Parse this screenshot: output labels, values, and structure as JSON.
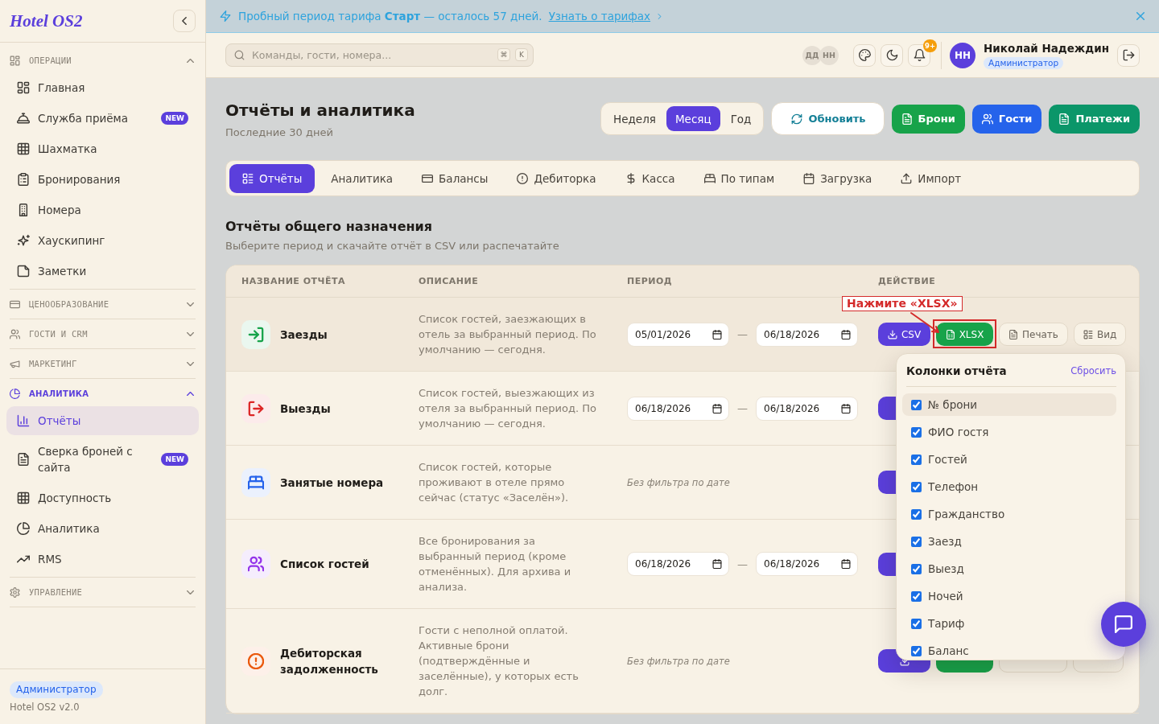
{
  "sidebar": {
    "logo": "Hotel OS2",
    "sections": [
      {
        "kind": "operations",
        "title": "ОПЕРАЦИИ",
        "expanded": true,
        "items": [
          {
            "kind": "dashboard",
            "label": "Главная",
            "selected": false
          },
          {
            "kind": "service-bell",
            "label": "Служба приёма",
            "selected": false,
            "badge": "NEW"
          },
          {
            "kind": "grid",
            "label": "Шахматка",
            "selected": false
          },
          {
            "kind": "clipboard",
            "label": "Бронирования",
            "selected": false
          },
          {
            "kind": "building",
            "label": "Номера",
            "selected": false
          },
          {
            "kind": "sparkles",
            "label": "Хаускипинг",
            "selected": false
          },
          {
            "kind": "note",
            "label": "Заметки",
            "selected": false
          }
        ]
      },
      {
        "kind": "pricing",
        "title": "ЦЕНООБРАЗОВАНИЕ",
        "expanded": false
      },
      {
        "kind": "crm",
        "title": "ГОСТИ И CRM",
        "expanded": false
      },
      {
        "kind": "marketing",
        "title": "МАРКЕТИНГ",
        "expanded": false
      },
      {
        "kind": "analytics",
        "title": "АНАЛИТИКА",
        "expanded": true,
        "items": [
          {
            "kind": "bar-chart",
            "label": "Отчёты",
            "selected": true
          },
          {
            "kind": "document",
            "label": "Сверка броней с сайта",
            "selected": false,
            "badge": "NEW"
          },
          {
            "kind": "grid",
            "label": "Доступность",
            "selected": false
          },
          {
            "kind": "pie-chart",
            "label": "Аналитика",
            "selected": false
          },
          {
            "kind": "trend",
            "label": "RMS",
            "selected": false
          }
        ]
      },
      {
        "kind": "settings",
        "title": "УПРАВЛЕНИЕ",
        "expanded": false
      }
    ],
    "footer": {
      "role": "Администратор",
      "version": "Hotel OS2 v2.0"
    }
  },
  "banner": {
    "text": "Пробный период тарифа **Старт** — осталось 57 дней.",
    "link": "Узнать о тарифах"
  },
  "topbar": {
    "search": {
      "placeholder": "Команды, гости, номера...",
      "shortcut": [
        "⌘",
        "K"
      ]
    },
    "presence": [
      "ДД",
      "НН"
    ],
    "notifications_badge": "9+",
    "user": {
      "initials": "НН",
      "name": "Николай Надеждин",
      "role": "Администратор"
    }
  },
  "page": {
    "title": "Отчёты и аналитика",
    "subtitle": "Последние 30 дней",
    "period_switch": [
      {
        "label": "Неделя",
        "selected": false
      },
      {
        "label": "Месяц",
        "selected": true
      },
      {
        "label": "Год",
        "selected": false
      }
    ],
    "actions": [
      {
        "kind": "refresh",
        "label": "Обновить"
      },
      {
        "kind": "bookings",
        "label": "Брони"
      },
      {
        "kind": "guests",
        "label": "Гости"
      },
      {
        "kind": "payments",
        "label": "Платежи"
      }
    ]
  },
  "tabs": [
    {
      "kind": "reports",
      "label": "Отчёты",
      "selected": true
    },
    {
      "kind": "analytics",
      "label": "Аналитика",
      "selected": false
    },
    {
      "kind": "balances",
      "label": "Балансы",
      "selected": false
    },
    {
      "kind": "receivables",
      "label": "Дебиторка",
      "selected": false
    },
    {
      "kind": "cash",
      "label": "Касса",
      "selected": false
    },
    {
      "kind": "types",
      "label": "По типам",
      "selected": false
    },
    {
      "kind": "load",
      "label": "Загрузка",
      "selected": false
    },
    {
      "kind": "import",
      "label": "Импорт",
      "selected": false
    }
  ],
  "section": {
    "title": "Отчёты общего назначения",
    "subtitle": "Выберите период и скачайте отчёт в CSV или распечатайте"
  },
  "table": {
    "columns": [
      "НАЗВАНИЕ ОТЧЁТА",
      "ОПИСАНИЕ",
      "ПЕРИОД",
      "ДЕЙСТВИЕ"
    ],
    "rows": [
      {
        "kind": "check-in",
        "color": "#16a34a",
        "name": "Заезды",
        "active": true,
        "description": "Список гостей, заезжающих в отель за выбранный период. По умолчанию — сегодня.",
        "period": {
          "from": "05/01/2026",
          "separator": "—",
          "to": "06/18/2026"
        },
        "actions": [
          {
            "kind": "csv",
            "label": "CSV",
            "highlighted": false
          },
          {
            "kind": "xlsx",
            "label": "XLSX",
            "highlighted": true
          },
          {
            "kind": "print",
            "label": "Печать",
            "highlighted": false
          },
          {
            "kind": "view",
            "label": "Вид",
            "highlighted": false
          }
        ]
      },
      {
        "kind": "check-out",
        "color": "#dc2626",
        "name": "Выезды",
        "active": false,
        "description": "Список гостей, выезжающих из отеля за выбранный период. По умолчанию — сегодня.",
        "period": {
          "from": "06/18/2026",
          "separator": "—",
          "to": "06/18/2026"
        },
        "actions": [
          {
            "kind": "csv"
          }
        ]
      },
      {
        "kind": "rooms",
        "color": "#2563eb",
        "name": "Занятые номера",
        "active": false,
        "description": "Список гостей, которые проживают в отеле прямо сейчас (статус «Заселён»).",
        "period": {
          "note": "Без фильтра по дате"
        },
        "actions": [
          {
            "kind": "csv"
          }
        ]
      },
      {
        "kind": "guests",
        "color": "#9333ea",
        "name": "Список гостей",
        "active": false,
        "description": "Все бронирования за выбранный период (кроме отменённых). Для архива и анализа.",
        "period": {
          "from": "06/18/2026",
          "separator": "—",
          "to": "06/18/2026"
        },
        "actions": [
          {
            "kind": "csv"
          }
        ]
      },
      {
        "kind": "debt",
        "color": "#ea580c",
        "name": "Дебиторская задолженность",
        "active": false,
        "description": "Гости с неполной оплатой. Активные брони (подтверждённые и заселённые), у которых есть долг.",
        "period": {
          "note": "Без фильтра по дате"
        },
        "actions": [
          {
            "kind": "csv"
          },
          {
            "kind": "xlsx"
          },
          {
            "kind": "print"
          },
          {
            "kind": "view"
          }
        ]
      }
    ]
  },
  "columns_popover": {
    "title": "Колонки отчёта",
    "reset": "Сбросить",
    "items": [
      {
        "label": "№ брони",
        "checked": true,
        "highlighted": true
      },
      {
        "label": "ФИО гостя",
        "checked": true,
        "highlighted": false
      },
      {
        "label": "Гостей",
        "checked": true,
        "highlighted": false
      },
      {
        "label": "Телефон",
        "checked": true,
        "highlighted": false
      },
      {
        "label": "Гражданство",
        "checked": true,
        "highlighted": false
      },
      {
        "label": "Заезд",
        "checked": true,
        "highlighted": false
      },
      {
        "label": "Выезд",
        "checked": true,
        "highlighted": false
      },
      {
        "label": "Ночей",
        "checked": true,
        "highlighted": false
      },
      {
        "label": "Тариф",
        "checked": true,
        "highlighted": false
      },
      {
        "label": "Баланс",
        "checked": true,
        "highlighted": false
      }
    ]
  },
  "callout": {
    "text": "Нажмите «XLSX»"
  }
}
